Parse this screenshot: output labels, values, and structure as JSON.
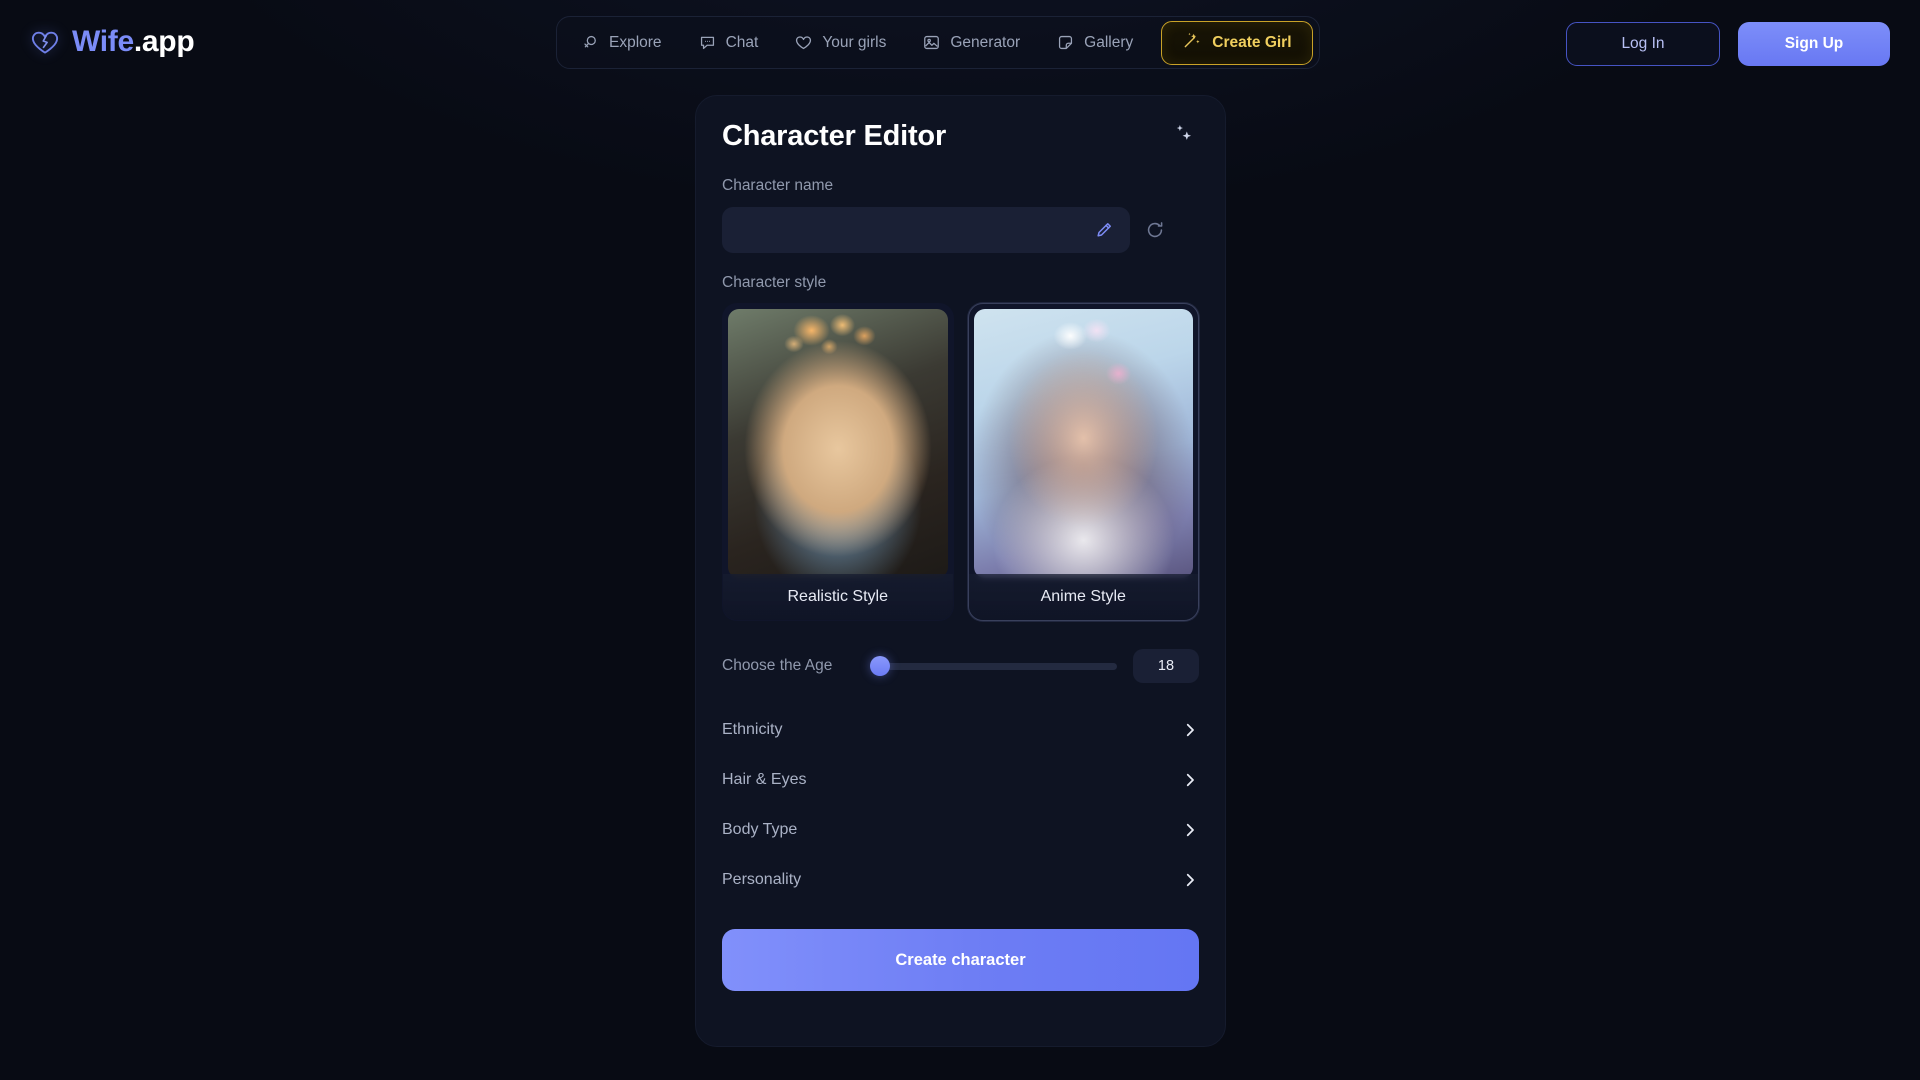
{
  "brand": {
    "icon": "broken-heart-icon",
    "name_primary": "Wife",
    "name_suffix": ".app"
  },
  "nav": {
    "items": [
      {
        "label": "Explore",
        "icon": "venus-search-icon"
      },
      {
        "label": "Chat",
        "icon": "chat-bubble-icon"
      },
      {
        "label": "Your girls",
        "icon": "heart-icon"
      },
      {
        "label": "Generator",
        "icon": "image-icon"
      },
      {
        "label": "Gallery",
        "icon": "sticker-icon"
      }
    ],
    "create_girl": {
      "label": "Create Girl",
      "icon": "magic-wand-icon",
      "accent": "#e8c65a"
    }
  },
  "auth": {
    "login_label": "Log In",
    "signup_label": "Sign Up",
    "signup_color": "#6d7df4"
  },
  "editor": {
    "title": "Character Editor",
    "header_icon": "sparkles-icon",
    "name": {
      "label": "Character name",
      "value": "",
      "placeholder": "",
      "edit_icon": "pencil-icon",
      "refresh_icon": "refresh-icon"
    },
    "style": {
      "label": "Character style",
      "options": [
        {
          "label": "Realistic Style",
          "selected": false
        },
        {
          "label": "Anime Style",
          "selected": true
        }
      ]
    },
    "age": {
      "label": "Choose the Age",
      "value": "18",
      "min": 18,
      "max": 60,
      "percent": 0
    },
    "sections": [
      {
        "label": "Ethnicity",
        "icon": "chevron-right-icon"
      },
      {
        "label": "Hair & Eyes",
        "icon": "chevron-right-icon"
      },
      {
        "label": "Body Type",
        "icon": "chevron-right-icon"
      },
      {
        "label": "Personality",
        "icon": "chevron-right-icon"
      }
    ],
    "submit_label": "Create character"
  }
}
